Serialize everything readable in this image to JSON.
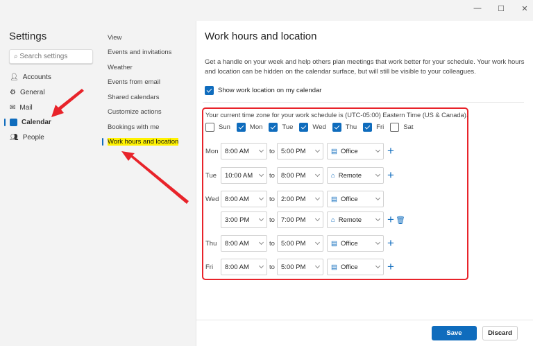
{
  "window": {
    "minimize": "—",
    "maximize": "☐",
    "close": "✕"
  },
  "sidebar": {
    "title": "Settings",
    "search_placeholder": "Search settings",
    "items": [
      {
        "label": "Accounts"
      },
      {
        "label": "General"
      },
      {
        "label": "Mail"
      },
      {
        "label": "Calendar",
        "selected": true
      },
      {
        "label": "People"
      }
    ]
  },
  "subnav": {
    "items": [
      {
        "label": "View"
      },
      {
        "label": "Events and invitations"
      },
      {
        "label": "Weather"
      },
      {
        "label": "Events from email"
      },
      {
        "label": "Shared calendars"
      },
      {
        "label": "Customize actions"
      },
      {
        "label": "Bookings with me"
      },
      {
        "label": "Work hours and location",
        "selected": true
      }
    ]
  },
  "main": {
    "title": "Work hours and location",
    "description": "Get a handle on your week and help others plan meetings that work better for your schedule. Your work hours and location can be hidden on the calendar surface, but will still be visible to your colleagues.",
    "show_location_label": "Show work location on my calendar",
    "show_location_checked": true,
    "timezone_text": "Your current time zone for your work schedule is (UTC-05:00) Eastern Time (US & Canada).",
    "days": [
      {
        "label": "Sun",
        "checked": false
      },
      {
        "label": "Mon",
        "checked": true
      },
      {
        "label": "Tue",
        "checked": true
      },
      {
        "label": "Wed",
        "checked": true
      },
      {
        "label": "Thu",
        "checked": true
      },
      {
        "label": "Fri",
        "checked": true
      },
      {
        "label": "Sat",
        "checked": false
      }
    ],
    "to_label": "to",
    "schedule": [
      {
        "day": "Mon",
        "start": "8:00 AM",
        "end": "5:00 PM",
        "location": "Office",
        "icon": "building-icon"
      },
      {
        "day": "Tue",
        "start": "10:00 AM",
        "end": "8:00 PM",
        "location": "Remote",
        "icon": "home-icon"
      },
      {
        "day": "Wed",
        "start": "8:00 AM",
        "end": "2:00 PM",
        "location": "Office",
        "icon": "building-icon"
      },
      {
        "day": "",
        "start": "3:00 PM",
        "end": "7:00 PM",
        "location": "Remote",
        "icon": "home-icon",
        "deletable": true
      },
      {
        "day": "Thu",
        "start": "8:00 AM",
        "end": "5:00 PM",
        "location": "Office",
        "icon": "building-icon"
      },
      {
        "day": "Fri",
        "start": "8:00 AM",
        "end": "5:00 PM",
        "location": "Office",
        "icon": "building-icon"
      }
    ]
  },
  "footer": {
    "save": "Save",
    "discard": "Discard"
  },
  "colors": {
    "accent": "#0f6cbd",
    "annotation": "#e8232a",
    "highlight": "#fff200"
  }
}
